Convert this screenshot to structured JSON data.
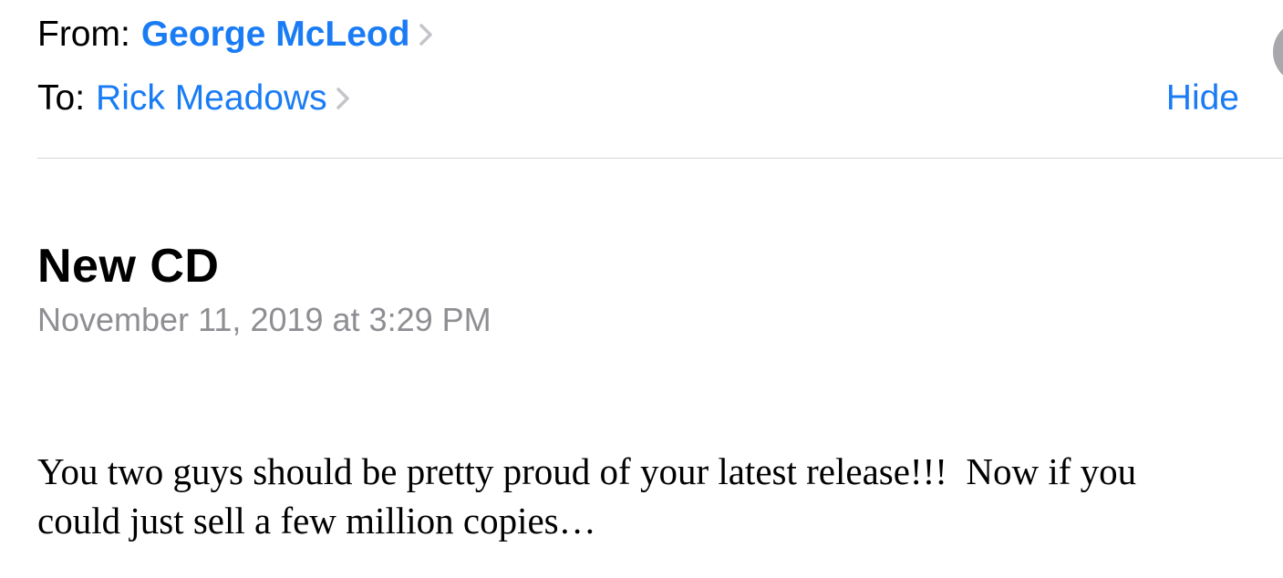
{
  "header": {
    "from_label": "From:",
    "from_name": "George McLeod",
    "to_label": "To:",
    "to_name": "Rick Meadows",
    "hide_label": "Hide"
  },
  "message": {
    "subject": "New CD",
    "date": "November 11, 2019 at 3:29 PM",
    "body_lines": [
      "You two guys should be pretty proud of your latest release!!!  Now if you",
      "could just sell a few million copies…"
    ]
  },
  "colors": {
    "link": "#1a7cf5",
    "secondary_text": "#8e8e93",
    "chevron": "#c4c4c9",
    "divider": "#d6d6d9",
    "avatar": "#a7a7ac"
  },
  "icons": {
    "from_chevron": "chevron-right-icon",
    "to_chevron": "chevron-right-icon"
  }
}
